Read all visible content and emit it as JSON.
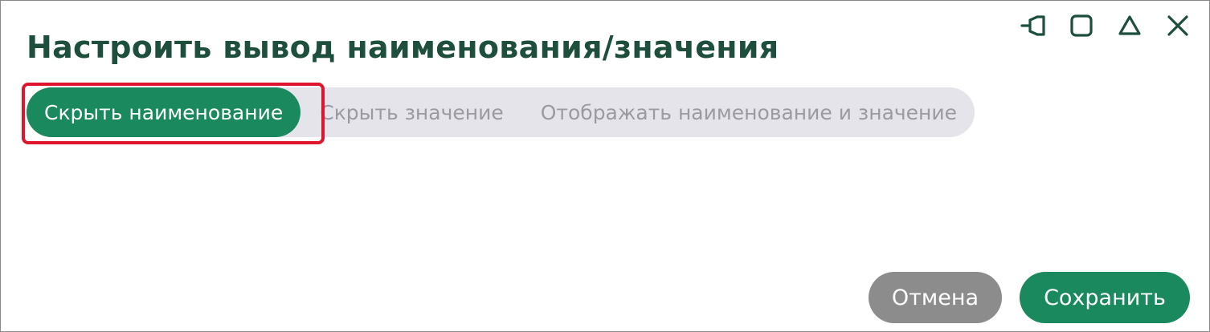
{
  "dialog": {
    "title": "Настроить вывод наименования/значения"
  },
  "window_controls": [
    {
      "icon": "pin-icon"
    },
    {
      "icon": "maximize-icon"
    },
    {
      "icon": "collapse-icon"
    },
    {
      "icon": "close-icon"
    }
  ],
  "options": {
    "selected": "Скрыть наименование",
    "items": [
      {
        "label": "Скрыть наименование"
      },
      {
        "label": "Скрыть значение"
      },
      {
        "label": "Отображать наименование и значение"
      }
    ]
  },
  "buttons": {
    "cancel_label": "Отмена",
    "save_label": "Сохранить"
  },
  "colors": {
    "accent": "#1a8a5e",
    "title": "#1e4f3d",
    "segment_bg": "#e4e4ea",
    "inactive_text": "#9a9a9f",
    "cancel_bg": "#8c8c8c",
    "highlight": "#e0142d"
  }
}
